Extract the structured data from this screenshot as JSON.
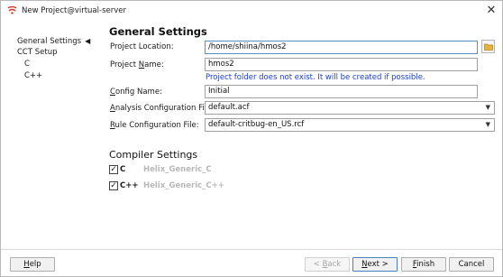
{
  "window": {
    "title": "New Project@virtual-server",
    "app_icon": "eclipse-style-app-icon",
    "close_glyph": "✕"
  },
  "nav": {
    "items": [
      {
        "label": "General Settings",
        "selected": true,
        "arrow": "◀"
      },
      {
        "label": "CCT Setup"
      },
      {
        "label": "C"
      },
      {
        "label": "C++"
      }
    ]
  },
  "general": {
    "heading": "General Settings",
    "project_location": {
      "label_pre": "Project Location:",
      "value": "/home/shiina/hmos2"
    },
    "project_name": {
      "label_pre": "Project ",
      "label_key": "N",
      "label_post": "ame:",
      "value": "hmos2"
    },
    "info_message": "Project folder does not exist. It will be created if possible.",
    "config_name": {
      "label_key": "C",
      "label_post": "onfig Name:",
      "value": "Initial"
    },
    "analysis_config": {
      "label_key": "A",
      "label_post": "nalysis Configuration File:",
      "value": "default.acf"
    },
    "rule_config": {
      "label_key": "R",
      "label_post": "ule Configuration File:",
      "value": "default-critbug-en_US.rcf"
    },
    "combo_arrow": "▼"
  },
  "compiler": {
    "heading": "Compiler Settings",
    "rows": [
      {
        "label": "C",
        "value": "Helix_Generic_C",
        "checked": true
      },
      {
        "label": "C++",
        "value": "Helix_Generic_C++",
        "checked": true
      }
    ],
    "check_glyph": "✓"
  },
  "footer": {
    "help": {
      "key": "H",
      "rest": "elp"
    },
    "back": {
      "pre": "< ",
      "key": "B",
      "rest": "ack",
      "enabled": false
    },
    "next": {
      "key": "N",
      "rest": "ext >"
    },
    "finish": {
      "key": "F",
      "rest": "inish"
    },
    "cancel": "Cancel"
  },
  "colors": {
    "info_text": "#1c3fbf",
    "disabled_text": "#b8b8b8",
    "focus_border": "#5a8ec9",
    "app_icon_red": "#d23a2a"
  }
}
